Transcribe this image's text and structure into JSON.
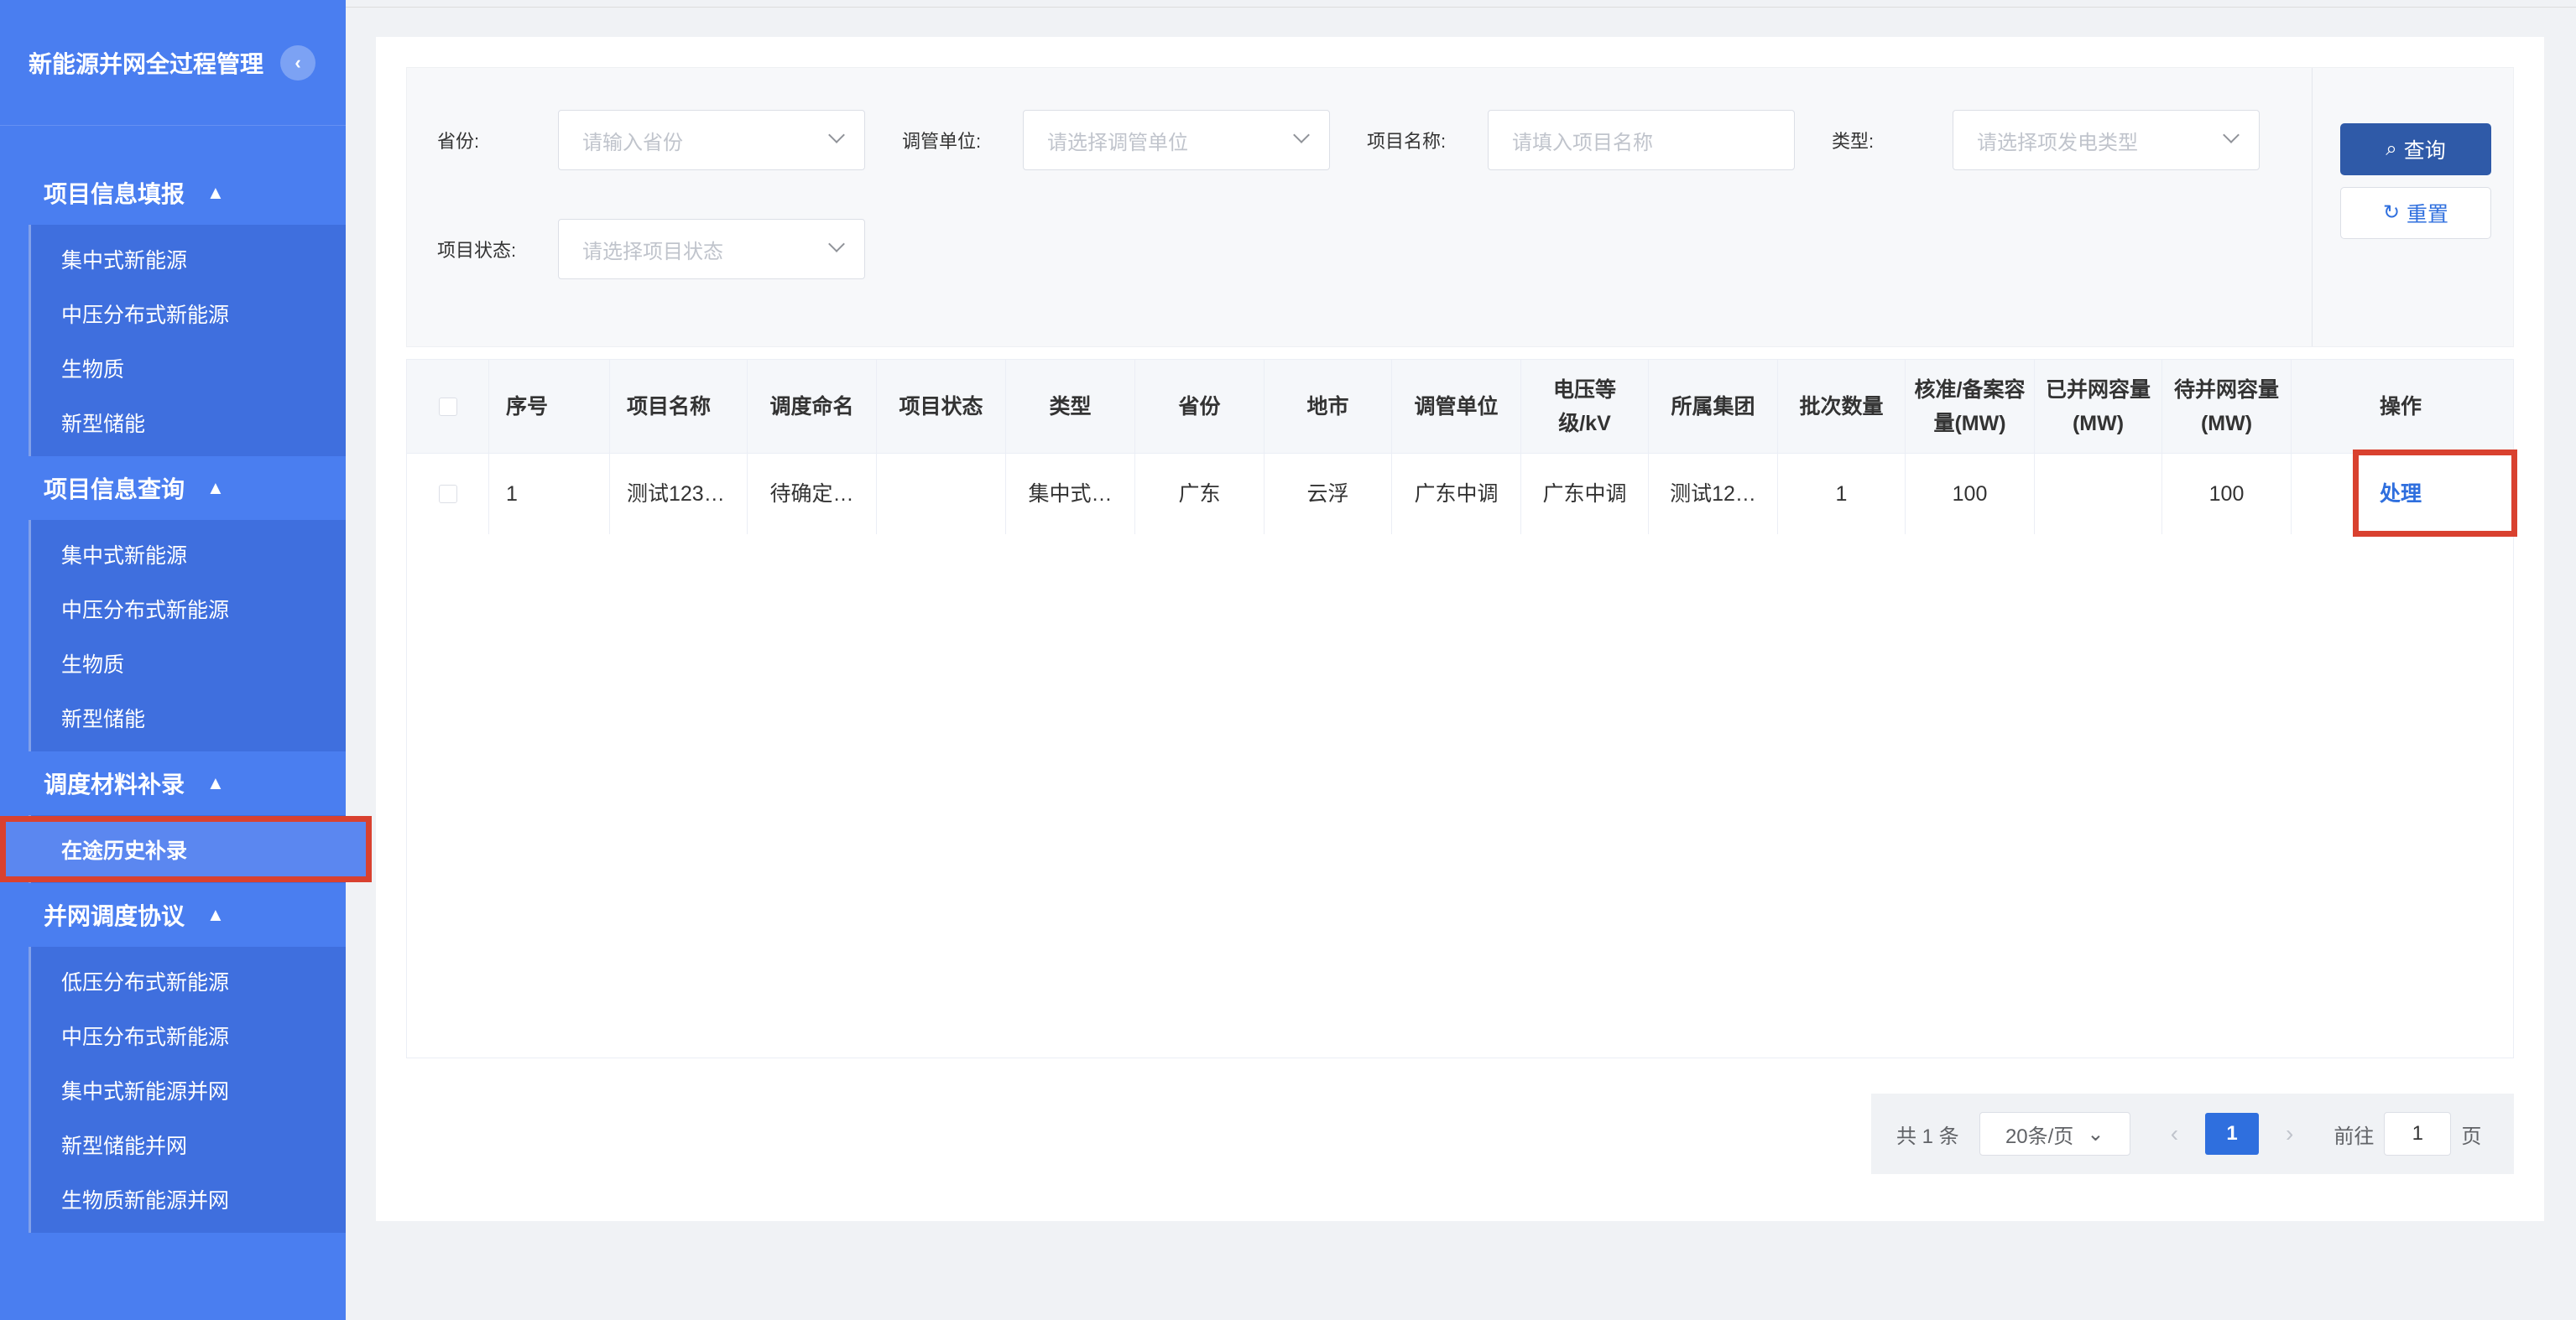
{
  "app": {
    "title": "新能源并网全过程管理",
    "collapse_icon": "‹"
  },
  "sidebar": {
    "groups": [
      {
        "title": "项目信息填报",
        "arrow": "▲",
        "items": [
          "集中式新能源",
          "中压分布式新能源",
          "生物质",
          "新型储能"
        ]
      },
      {
        "title": "项目信息查询",
        "arrow": "▲",
        "items": [
          "集中式新能源",
          "中压分布式新能源",
          "生物质",
          "新型储能"
        ]
      },
      {
        "title": "调度材料补录",
        "arrow": "▲",
        "items": [
          "在途历史补录"
        ]
      },
      {
        "title": "并网调度协议",
        "arrow": "▲",
        "items": [
          "低压分布式新能源",
          "中压分布式新能源",
          "集中式新能源并网",
          "新型储能并网",
          "生物质新能源并网"
        ]
      }
    ],
    "active_item": "在途历史补录"
  },
  "filters": {
    "province": {
      "label": "省份:",
      "placeholder": "请输入省份"
    },
    "dispatch_unit": {
      "label": "调管单位:",
      "placeholder": "请选择调管单位"
    },
    "project_name": {
      "label": "项目名称:",
      "placeholder": "请填入项目名称"
    },
    "type": {
      "label": "类型:",
      "placeholder": "请选择项发电类型"
    },
    "project_status": {
      "label": "项目状态:",
      "placeholder": "请选择项目状态"
    },
    "query_label": "查询",
    "reset_label": "重置"
  },
  "table": {
    "headers": {
      "index": "序号",
      "project_name": "项目名称",
      "dispatch_name": "调度命名",
      "project_status": "项目状态",
      "type": "类型",
      "province": "省份",
      "city": "地市",
      "dispatch_unit": "调管单位",
      "voltage": "电压等级/kV",
      "group": "所属集团",
      "batch_count": "批次数量",
      "approved_capacity": "核准/备案容量(MW)",
      "connected_capacity": "已并网容量(MW)",
      "pending_capacity": "待并网容量(MW)",
      "action": "操作"
    },
    "rows": [
      {
        "index": "1",
        "project_name": "测试123…",
        "dispatch_name": "待确定…",
        "project_status": "",
        "type": "集中式…",
        "province": "广东",
        "city": "云浮",
        "dispatch_unit": "广东中调",
        "voltage": "广东中调",
        "group": "测试12…",
        "batch_count": "1",
        "approved_capacity": "100",
        "connected_capacity": "",
        "pending_capacity": "100",
        "action": "处理"
      }
    ]
  },
  "pagination": {
    "total": "共 1 条",
    "page_size": "20条/页",
    "current_page": "1",
    "goto_label": "前往",
    "goto_value": "1",
    "page_unit": "页"
  },
  "colors": {
    "sidebar": "#4a7ef0",
    "primary_button": "#2f5aa8",
    "link": "#2f6fde",
    "highlight": "#d9412f"
  }
}
